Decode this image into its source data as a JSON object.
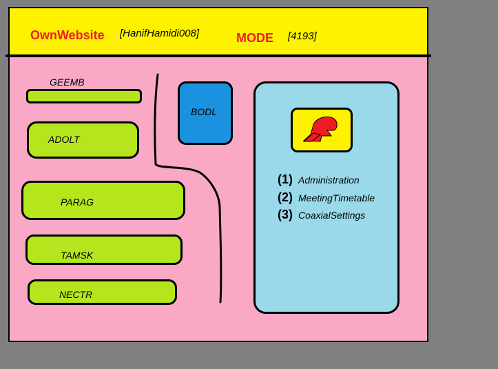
{
  "header": {
    "brand": "OwnWebsite",
    "user": "[HanifHamidi008]",
    "mode_label": "MODE",
    "mode_value": "[4193]"
  },
  "sidebar": {
    "items": [
      {
        "label": "GEEMB"
      },
      {
        "label": "ADOLT"
      },
      {
        "label": "PARAG"
      },
      {
        "label": "TAMSK"
      },
      {
        "label": "NECTR"
      }
    ]
  },
  "main": {
    "bodl_label": "BODL",
    "logo_icon": "red-swoosh-logo-icon",
    "menu": [
      {
        "number": "(1)",
        "label": "Administration"
      },
      {
        "number": "(2)",
        "label": "MeetingTimetable"
      },
      {
        "number": "(3)",
        "label": "CoaxialSettings"
      }
    ]
  },
  "colors": {
    "background": "#808080",
    "page": "#f9a9c5",
    "header": "#fff200",
    "accent_red": "#ee1c24",
    "pill_green": "#b5e61d",
    "button_blue": "#1b92e0",
    "panel_blue": "#99d9ea"
  }
}
